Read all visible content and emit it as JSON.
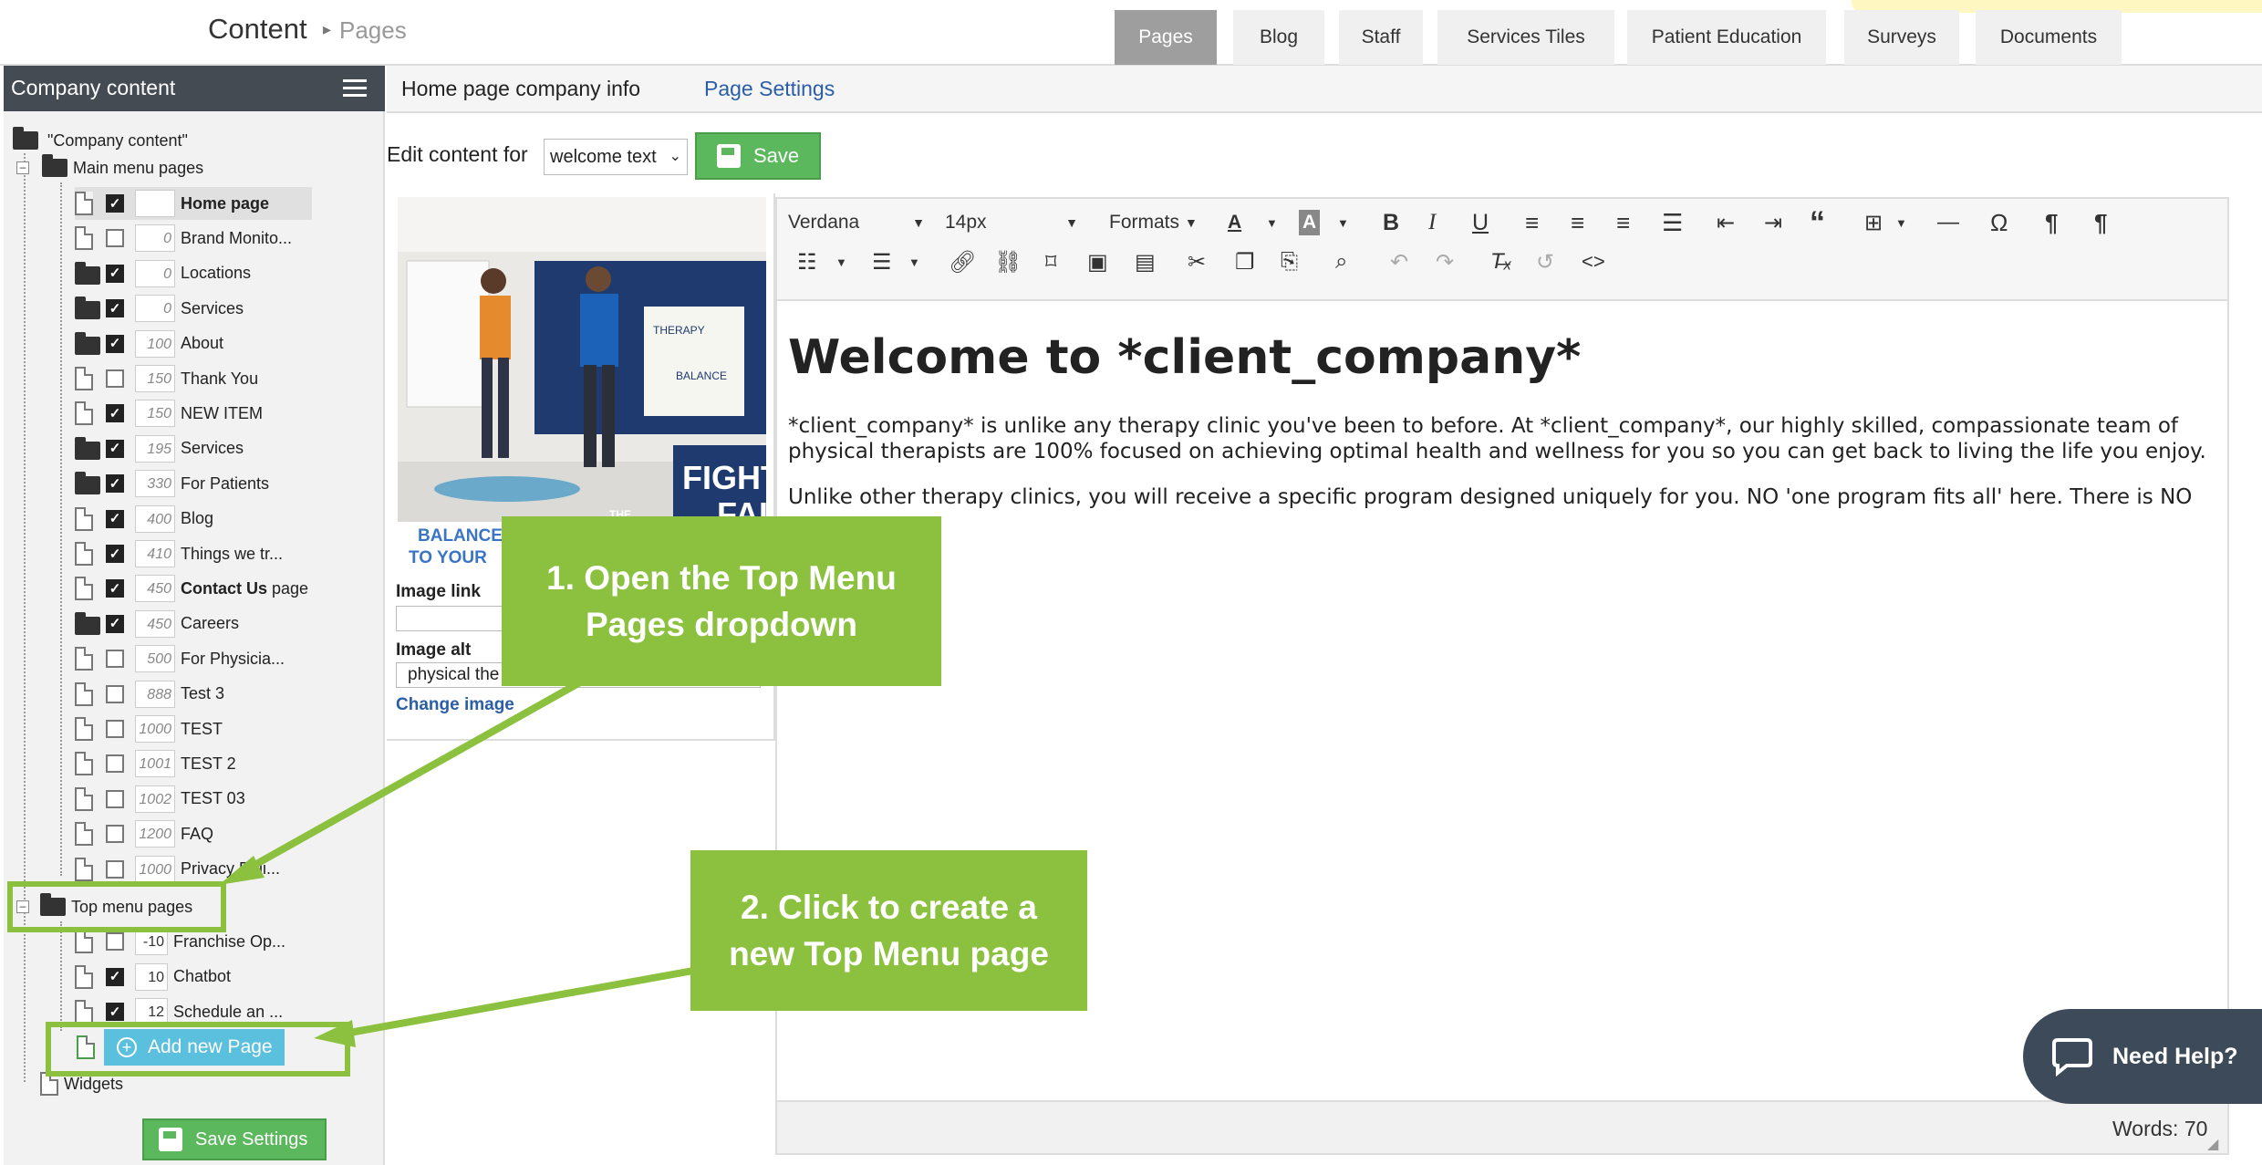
{
  "breadcrumb": {
    "main": "Content",
    "sep": "▸",
    "sub": "Pages"
  },
  "top_tabs": [
    "Pages",
    "Blog",
    "Staff",
    "Services Tiles",
    "Patient Education",
    "Surveys",
    "Documents"
  ],
  "sidebar": {
    "title": "Company content",
    "root_label": "\"Company content\"",
    "main_menu_label": "Main menu pages",
    "main_items": [
      {
        "order": "",
        "label": "Home page",
        "checked": true,
        "folder": false
      },
      {
        "order": "0",
        "label": "Brand Monito...",
        "checked": false,
        "folder": false
      },
      {
        "order": "0",
        "label": "Locations",
        "checked": true,
        "folder": true
      },
      {
        "order": "0",
        "label": "Services",
        "checked": true,
        "folder": true
      },
      {
        "order": "100",
        "label": "About",
        "checked": true,
        "folder": true
      },
      {
        "order": "150",
        "label": "Thank You",
        "checked": false,
        "folder": false
      },
      {
        "order": "150",
        "label": "NEW ITEM",
        "checked": true,
        "folder": false
      },
      {
        "order": "195",
        "label": "Services",
        "checked": true,
        "folder": true
      },
      {
        "order": "330",
        "label": "For Patients",
        "checked": true,
        "folder": true
      },
      {
        "order": "400",
        "label": "Blog",
        "checked": true,
        "folder": false
      },
      {
        "order": "410",
        "label": "Things we tr...",
        "checked": true,
        "folder": false
      },
      {
        "order": "450",
        "label": "Contact Us",
        "label_suffix": " page",
        "checked": true,
        "folder": false
      },
      {
        "order": "450",
        "label": "Careers",
        "checked": true,
        "folder": true
      },
      {
        "order": "500",
        "label": "For Physicia...",
        "checked": false,
        "folder": false
      },
      {
        "order": "888",
        "label": "Test 3",
        "checked": false,
        "folder": false
      },
      {
        "order": "1000",
        "label": "TEST",
        "checked": false,
        "folder": false
      },
      {
        "order": "1001",
        "label": "TEST 2",
        "checked": false,
        "folder": false
      },
      {
        "order": "1002",
        "label": "TEST 03",
        "checked": false,
        "folder": false
      },
      {
        "order": "1200",
        "label": "FAQ",
        "checked": false,
        "folder": false
      },
      {
        "order": "1000",
        "label": "Privacy Poli...",
        "checked": false,
        "folder": false
      }
    ],
    "top_menu_label": "Top menu pages",
    "top_items": [
      {
        "order": "-10",
        "label": "Franchise Op...",
        "checked": false
      },
      {
        "order": "10",
        "label": "Chatbot",
        "checked": true
      },
      {
        "order": "12",
        "label": "Schedule an ...",
        "checked": true
      }
    ],
    "add_new_page": "Add new Page",
    "widgets_label": "Widgets",
    "save_settings": "Save Settings"
  },
  "subheader": {
    "tab1": "Home page company info",
    "tab2": "Page Settings"
  },
  "edit": {
    "label": "Edit content for",
    "select_value": "welcome text",
    "save": "Save"
  },
  "image_panel": {
    "photo_text_fight": "FIGHT",
    "photo_text_the": "THE",
    "photo_text_fall": "FALL",
    "photo_text_balance1": "BALANCE",
    "photo_text_balance2": "TO YOUR",
    "photo_wall_therapy": "THERAPY",
    "photo_wall_balance": "BALANCE",
    "image_link_label": "Image link",
    "image_link_value": "",
    "image_alt_label": "Image alt",
    "image_alt_value": "physical the",
    "change_image": "Change image"
  },
  "toolbar": {
    "font": "Verdana",
    "size": "14px",
    "formats": "Formats"
  },
  "content": {
    "heading": "Welcome to *client_company*",
    "p1_line1": "*client_company* is unlike any therapy clinic you've been to before. At *client_company*, our highly skilled, compassionate team of",
    "p1_line2": "physical therapists are 100% focused on achieving optimal health and wellness for you so you can get back to living the life you enjoy.",
    "p2_line1": "Unlike other therapy clinics, you will receive a specific program designed uniquely for you. NO 'one program fits all' here. There is NO"
  },
  "status": {
    "words": "Words: 70"
  },
  "help": {
    "label": "Need Help?"
  },
  "callouts": {
    "c1_line1": "1. Open the Top Menu",
    "c1_line2": "Pages dropdown",
    "c2_line1": "2. Click to create a",
    "c2_line2": "new Top Menu page"
  },
  "colors": {
    "accent_green": "#8cc13f",
    "save_green": "#5cb85c",
    "add_blue": "#5bc0de",
    "sidebar_head": "#444b53",
    "link_blue": "#2a5ea6"
  }
}
